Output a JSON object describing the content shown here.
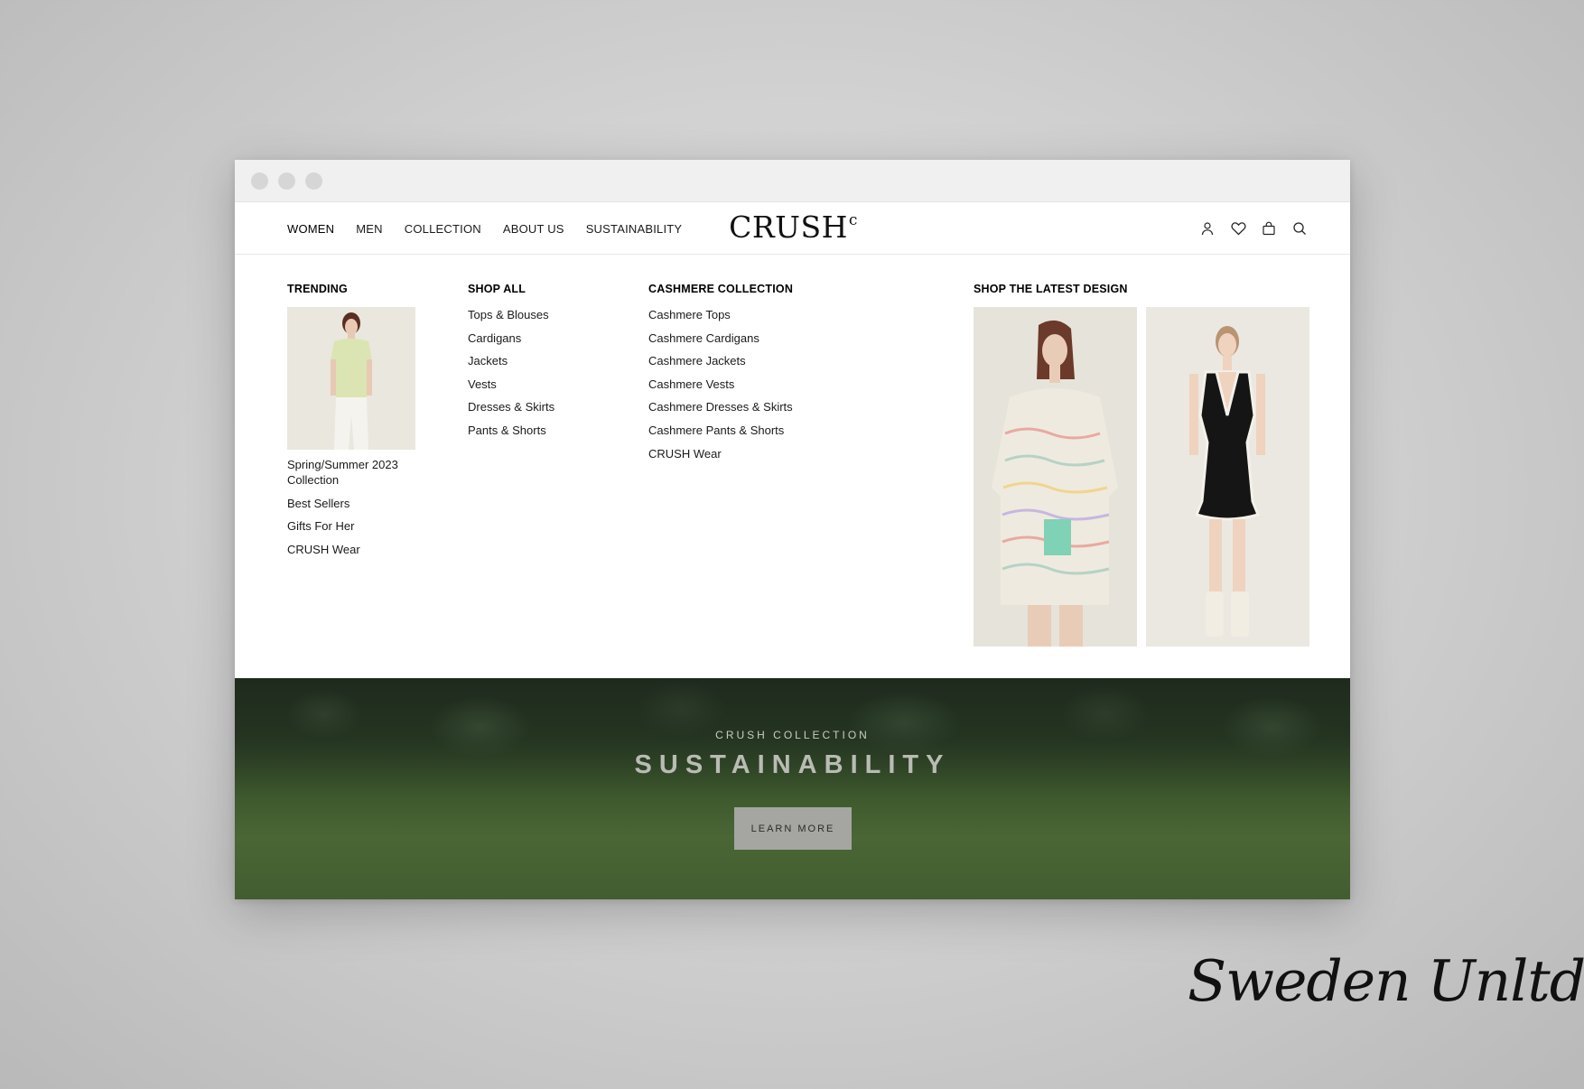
{
  "nav": {
    "links": [
      "WOMEN",
      "MEN",
      "COLLECTION",
      "ABOUT US",
      "SUSTAINABILITY"
    ],
    "logo": "CRUSH",
    "logo_mark": "c",
    "icons": [
      "user-icon",
      "heart-icon",
      "bag-icon",
      "search-icon"
    ]
  },
  "mega": {
    "trending": {
      "heading": "TRENDING",
      "items": [
        "Spring/Summer 2023 Collection",
        "Best Sellers",
        "Gifts For Her",
        "CRUSH Wear"
      ]
    },
    "shop_all": {
      "heading": "SHOP ALL",
      "items": [
        "Tops & Blouses",
        "Cardigans",
        "Jackets",
        "Vests",
        "Dresses & Skirts",
        "Pants & Shorts"
      ]
    },
    "cashmere": {
      "heading": "CASHMERE COLLECTION",
      "items": [
        "Cashmere Tops",
        "Cashmere Cardigans",
        "Cashmere Jackets",
        "Cashmere Vests",
        "Cashmere Dresses & Skirts",
        "Cashmere Pants & Shorts",
        "CRUSH Wear"
      ]
    },
    "latest": {
      "heading": "SHOP THE LATEST DESIGN"
    }
  },
  "hero": {
    "kicker": "CRUSH COLLECTION",
    "title": "SUSTAINABILITY",
    "button": "LEARN MORE"
  },
  "signature": "Sweden Unltd",
  "colors": {
    "hero_green": "#3f5a2e",
    "button_grey": "#a5a6a1",
    "chrome": "#f0f0f0"
  }
}
